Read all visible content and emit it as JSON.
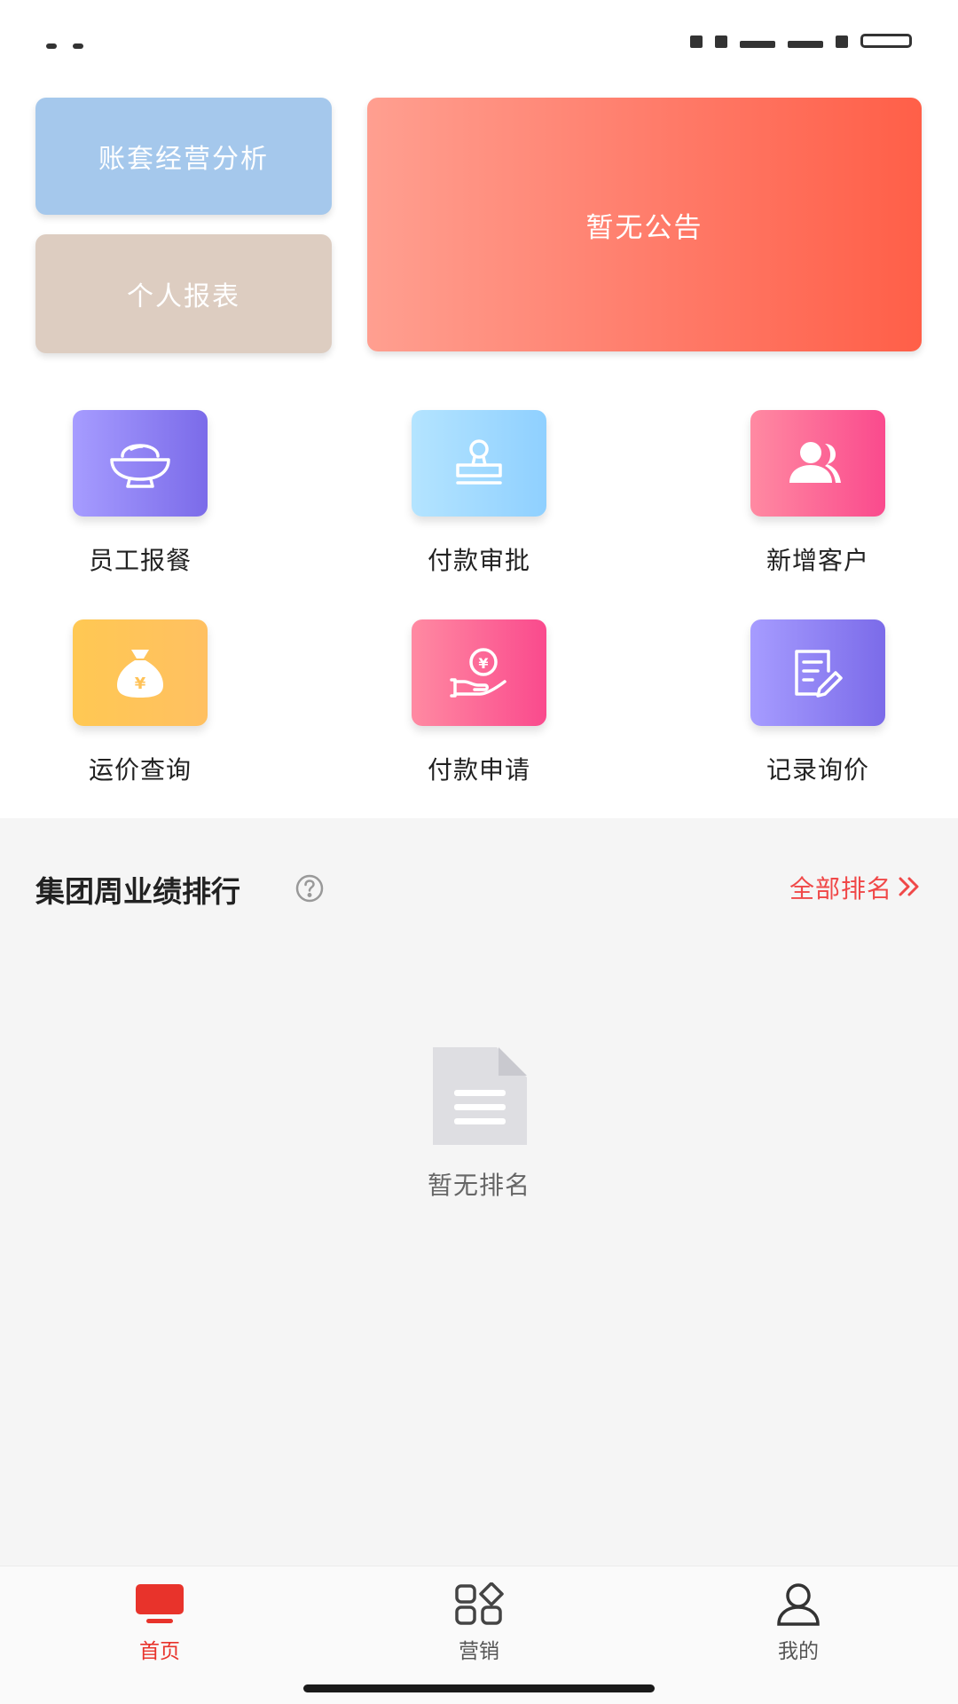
{
  "tiles": {
    "analysis_label": "账套经营分析",
    "report_label": "个人报表",
    "notice_label": "暂无公告"
  },
  "grid": [
    {
      "label": "员工报餐",
      "icon": "rice-bowl-icon"
    },
    {
      "label": "付款审批",
      "icon": "stamp-icon"
    },
    {
      "label": "新增客户",
      "icon": "users-icon"
    },
    {
      "label": "运价查询",
      "icon": "money-bag-icon"
    },
    {
      "label": "付款申请",
      "icon": "hand-coin-icon"
    },
    {
      "label": "记录询价",
      "icon": "edit-note-icon"
    }
  ],
  "ranking": {
    "title": "集团周业绩排行",
    "view_all": "全部排名",
    "empty_text": "暂无排名"
  },
  "nav": [
    {
      "label": "首页",
      "icon": "home-tv-icon",
      "active": true
    },
    {
      "label": "营销",
      "icon": "grid-diamond-icon",
      "active": false
    },
    {
      "label": "我的",
      "icon": "user-icon",
      "active": false
    }
  ],
  "colors": {
    "accent_red": "#e8332b",
    "rank_link": "#f04848",
    "notice_gradient_start": "#ff9f90",
    "notice_gradient_end": "#ff5f48",
    "analysis_tile": "#a5c8ec",
    "report_tile": "#ddcdc1"
  }
}
